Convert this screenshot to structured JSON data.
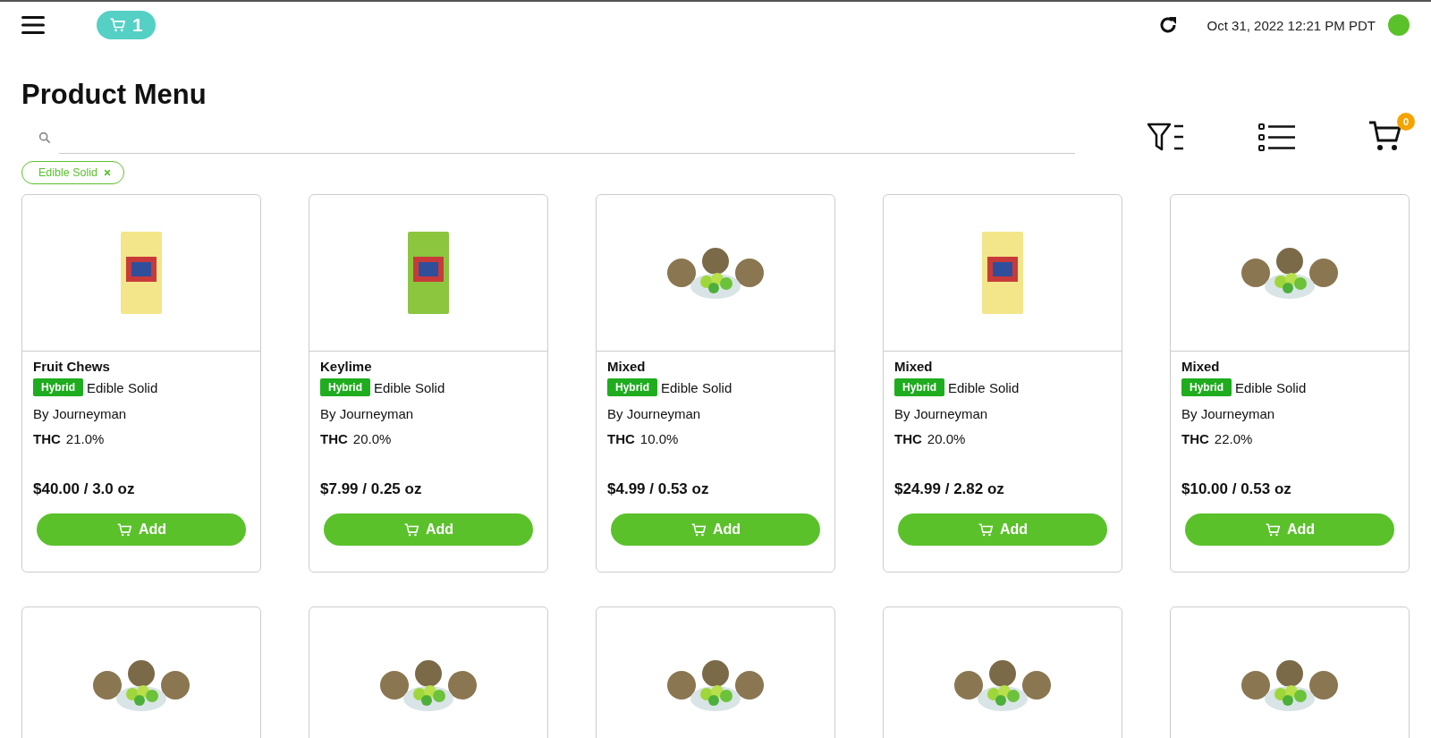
{
  "topbar": {
    "cart_count": "1",
    "datetime": "Oct 31, 2022 12:21 PM PDT"
  },
  "title": "Product Menu",
  "cart": {
    "badge": "0"
  },
  "filters": [
    {
      "label": "Edible Solid"
    }
  ],
  "products": [
    {
      "kind": "package",
      "color": "#f3e58a",
      "name": "Fruit Chews",
      "strain": "Hybrid",
      "category": "Edible Solid",
      "brand": "By Journeyman",
      "thc_label": "THC",
      "thc": "21.0%",
      "price": "$40.00 / 3.0 oz",
      "button": "Add"
    },
    {
      "kind": "package",
      "color": "#8cc63f",
      "name": "Keylime",
      "strain": "Hybrid",
      "category": "Edible Solid",
      "brand": "By Journeyman",
      "thc_label": "THC",
      "thc": "20.0%",
      "price": "$7.99 / 0.25 oz",
      "button": "Add"
    },
    {
      "kind": "bowl",
      "name": "Mixed",
      "strain": "Hybrid",
      "category": "Edible Solid",
      "brand": "By Journeyman",
      "thc_label": "THC",
      "thc": "10.0%",
      "price": "$4.99 / 0.53 oz",
      "button": "Add"
    },
    {
      "kind": "package",
      "color": "#f3e58a",
      "name": "Mixed",
      "strain": "Hybrid",
      "category": "Edible Solid",
      "brand": "By Journeyman",
      "thc_label": "THC",
      "thc": "20.0%",
      "price": "$24.99 / 2.82 oz",
      "button": "Add"
    },
    {
      "kind": "bowl",
      "name": "Mixed",
      "strain": "Hybrid",
      "category": "Edible Solid",
      "brand": "By Journeyman",
      "thc_label": "THC",
      "thc": "22.0%",
      "price": "$10.00 / 0.53 oz",
      "button": "Add"
    },
    {
      "kind": "bowl"
    },
    {
      "kind": "bowl"
    },
    {
      "kind": "bowl"
    },
    {
      "kind": "bowl"
    },
    {
      "kind": "bowl"
    }
  ]
}
